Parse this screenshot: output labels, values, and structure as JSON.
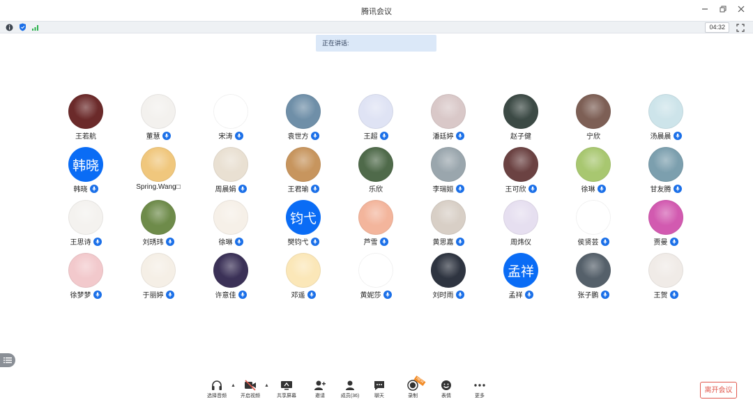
{
  "window": {
    "title": "腾讯会议"
  },
  "status": {
    "timer": "04:32"
  },
  "speaking": {
    "label": "正在讲话:"
  },
  "participants": [
    {
      "name": "王若航",
      "mic": false,
      "color": "#6b2a2a"
    },
    {
      "name": "董慧",
      "mic": true,
      "color": "#f3f1ee"
    },
    {
      "name": "宋涛",
      "mic": true,
      "color": "#ffffff"
    },
    {
      "name": "袁世方",
      "mic": true,
      "color": "#6f8fa8"
    },
    {
      "name": "王超",
      "mic": true,
      "color": "#dfe3f4"
    },
    {
      "name": "潘廷婷",
      "mic": true,
      "color": "#d9c8c8"
    },
    {
      "name": "赵子健",
      "mic": false,
      "color": "#3c4a45"
    },
    {
      "name": "宁欣",
      "mic": false,
      "color": "#7d5f55"
    },
    {
      "name": "汤晨晨",
      "mic": true,
      "color": "#cde4ea"
    },
    {
      "name": "韩晓",
      "mic": true,
      "text": "韩晓"
    },
    {
      "name": "Spring.Wang□",
      "mic": false,
      "color": "#f0c77d"
    },
    {
      "name": "周晨娟",
      "mic": true,
      "color": "#e9e0d2"
    },
    {
      "name": "王君瑜",
      "mic": true,
      "color": "#c7955e"
    },
    {
      "name": "乐欣",
      "mic": false,
      "color": "#4f6a4a"
    },
    {
      "name": "李瑞姮",
      "mic": true,
      "color": "#9aa6ad"
    },
    {
      "name": "王可欣",
      "mic": true,
      "color": "#6b4242"
    },
    {
      "name": "徐琳",
      "mic": true,
      "color": "#a8c770"
    },
    {
      "name": "甘友腾",
      "mic": true,
      "color": "#7c9fae"
    },
    {
      "name": "王思诗",
      "mic": true,
      "color": "#f4f2ef"
    },
    {
      "name": "刘琇玮",
      "mic": true,
      "color": "#6e8b4a"
    },
    {
      "name": "徐琳",
      "mic": true,
      "color": "#f6f0e8"
    },
    {
      "name": "樊钧弋",
      "mic": true,
      "text": "钧弋"
    },
    {
      "name": "芦雪",
      "mic": true,
      "color": "#f3b59c"
    },
    {
      "name": "黄思嘉",
      "mic": true,
      "color": "#d8cfc6"
    },
    {
      "name": "周炜仪",
      "mic": false,
      "color": "#e6dff0"
    },
    {
      "name": "侯贤芸",
      "mic": true,
      "color": "#ffffff"
    },
    {
      "name": "贾曼",
      "mic": true,
      "color": "#d25ab0"
    },
    {
      "name": "徐梦梦",
      "mic": true,
      "color": "#f2c9cc"
    },
    {
      "name": "于丽婷",
      "mic": true,
      "color": "#f5efe6"
    },
    {
      "name": "许意佳",
      "mic": true,
      "color": "#3b3157"
    },
    {
      "name": "邓遥",
      "mic": true,
      "color": "#fbe7b8"
    },
    {
      "name": "黄妮莎",
      "mic": true,
      "color": "#ffffff"
    },
    {
      "name": "刘时雨",
      "mic": true,
      "color": "#2e3440"
    },
    {
      "name": "孟祥",
      "mic": true,
      "text": "孟祥"
    },
    {
      "name": "张子鹏",
      "mic": true,
      "color": "#55606a"
    },
    {
      "name": "王贺",
      "mic": true,
      "color": "#f0ebe7"
    }
  ],
  "toolbar": {
    "audio_label": "选择音频",
    "video_label": "开启视频",
    "share_label": "共享屏幕",
    "invite_label": "邀请",
    "members_label": "成员(36)",
    "chat_label": "聊天",
    "record_label": "录制",
    "record_badge": "NEW",
    "reaction_label": "表情",
    "more_label": "更多"
  },
  "leave": {
    "label": "离开会议"
  },
  "colors": {
    "accent": "#1a6fe8",
    "leave": "#e0584d"
  }
}
